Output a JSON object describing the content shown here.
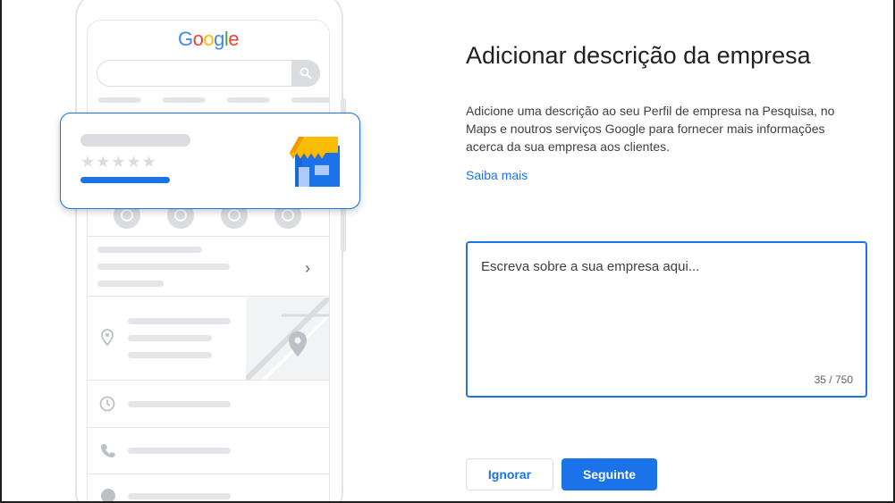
{
  "illustration": {
    "logo": {
      "letters": [
        "G",
        "o",
        "o",
        "g",
        "l",
        "e"
      ],
      "colors": [
        "#4285F4",
        "#EA4335",
        "#FBBC05",
        "#4285F4",
        "#34A853",
        "#EA4335"
      ]
    },
    "stars": "★★★★★",
    "chevron": "›"
  },
  "panel": {
    "title": "Adicionar descrição da empresa",
    "description": "Adicione uma descrição ao seu Perfil de empresa na Pesquisa, no Maps e noutros serviços Google para fornecer mais informações acerca da sua empresa aos clientes.",
    "learn_more": "Saiba mais",
    "textarea": {
      "placeholder": "Escreva sobre a sua empresa aqui...",
      "counter": "35 / 750"
    },
    "skip_button": "Ignorar",
    "next_button": "Seguinte"
  },
  "colors": {
    "accent": "#1a73e8",
    "placeholder_gray": "#dadce0"
  }
}
